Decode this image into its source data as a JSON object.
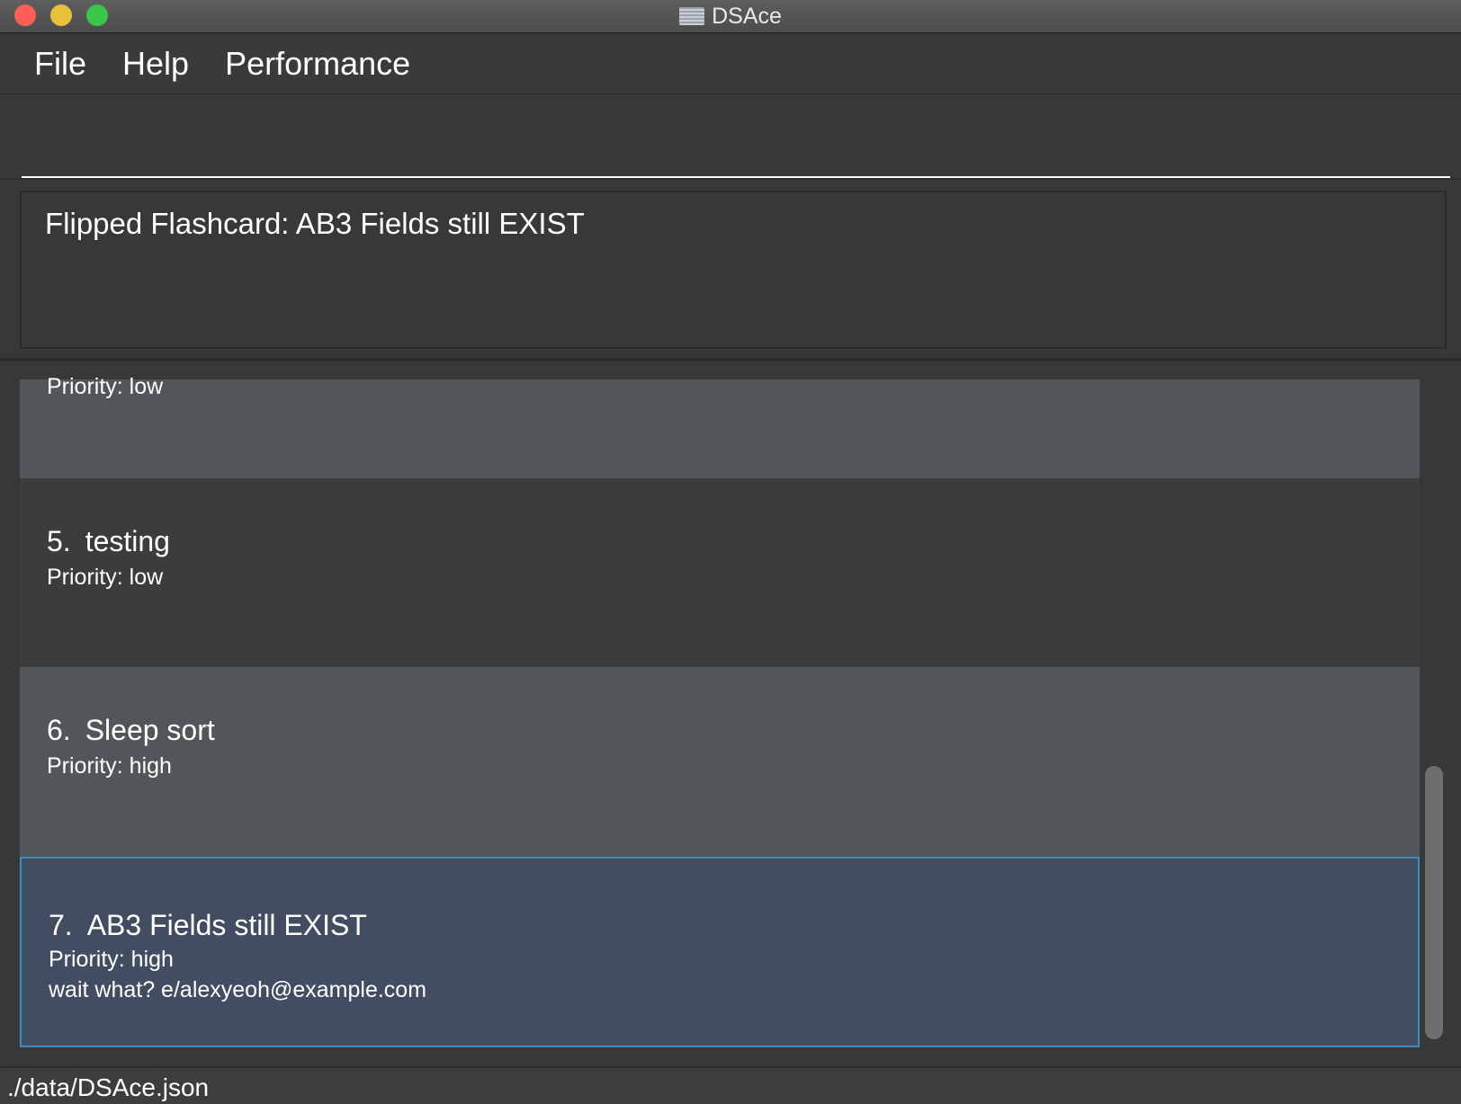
{
  "window": {
    "title": "DSAce"
  },
  "menu": {
    "file": "File",
    "help": "Help",
    "performance": "Performance"
  },
  "command": {
    "value": "",
    "placeholder": ""
  },
  "result": {
    "text": "Flipped Flashcard: AB3 Fields still EXIST"
  },
  "cards": [
    {
      "index": "",
      "title": "",
      "priority": "Priority: low",
      "note": ""
    },
    {
      "index": "5.",
      "title": "testing",
      "priority": "Priority: low",
      "note": ""
    },
    {
      "index": "6.",
      "title": "Sleep sort",
      "priority": "Priority: high",
      "note": ""
    },
    {
      "index": "7.",
      "title": "AB3 Fields still EXIST",
      "priority": "Priority: high",
      "note": "wait what? e/alexyeoh@example.com",
      "selected": true
    }
  ],
  "status": {
    "file_path": "./data/DSAce.json"
  },
  "colors": {
    "background": "#383838",
    "card_alt": "#515658",
    "card_dark": "#3b3c3e",
    "card_selected": "#424d61",
    "selected_border": "#3d8dbf"
  }
}
